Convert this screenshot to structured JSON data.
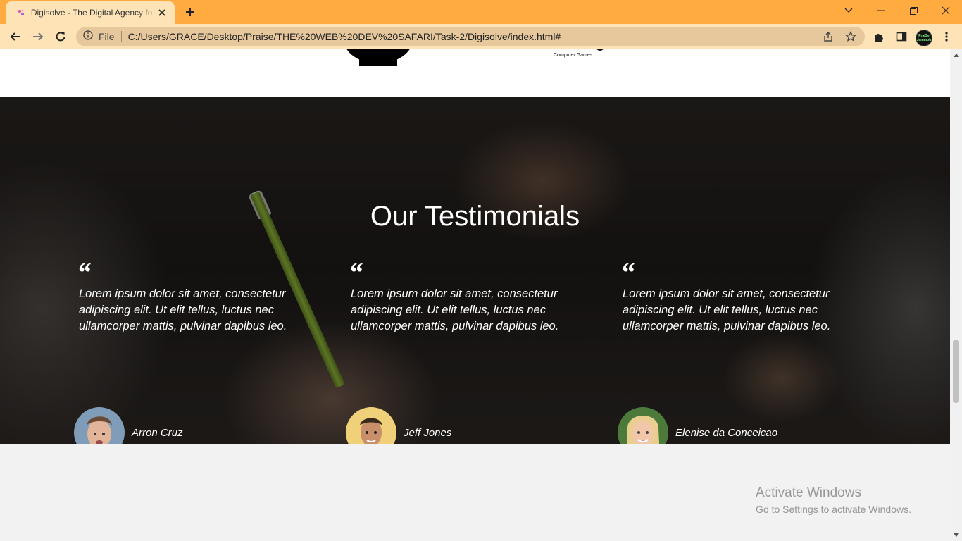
{
  "browser": {
    "tab_title": "Digisolve - The Digital Agency fo",
    "tab_accent": "#ffab40",
    "toolbar_color": "#fde3b6",
    "scheme_label": "File",
    "url": "C:/Users/GRACE/Desktop/Praise/THE%20WEB%20DEV%20SAFARI/Task-2/Digisolve/index.html#",
    "profile_line1": "PraiSe",
    "profile_line2": "Jammoh"
  },
  "clients": {
    "caption": "Computer Games"
  },
  "testimonials": {
    "heading": "Our Testimonials",
    "quote_glyph": "“",
    "cards": [
      {
        "quote": "Lorem ipsum dolor sit amet, consectetur adipiscing elit. Ut elit tellus, luctus nec ullamcorper mattis, pulvinar dapibus leo.",
        "author": "Arron Cruz"
      },
      {
        "quote": "Lorem ipsum dolor sit amet, consectetur adipiscing elit. Ut elit tellus, luctus nec ullamcorper mattis, pulvinar dapibus leo.",
        "author": "Jeff Jones"
      },
      {
        "quote": "Lorem ipsum dolor sit amet, consectetur adipiscing elit. Ut elit tellus, luctus nec ullamcorper mattis, pulvinar dapibus leo.",
        "author": "Elenise da Conceicao"
      }
    ]
  },
  "watermark": {
    "line1": "Activate Windows",
    "line2": "Go to Settings to activate Windows."
  }
}
